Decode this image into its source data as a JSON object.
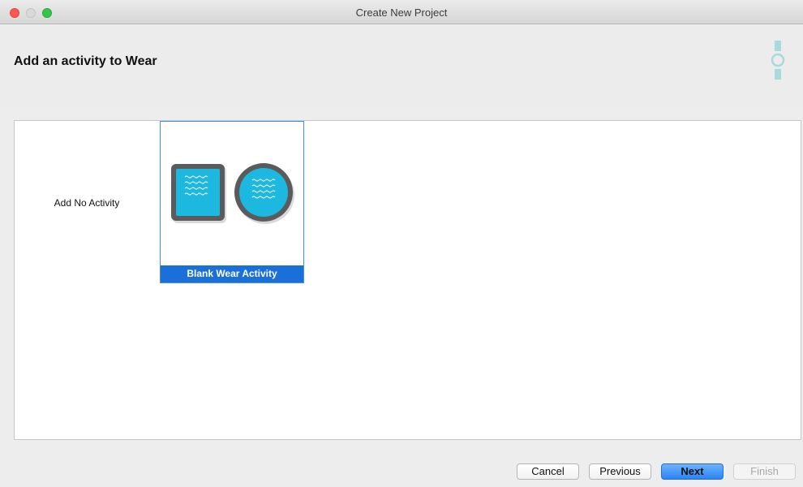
{
  "window": {
    "title": "Create New Project"
  },
  "header": {
    "title": "Add an activity to Wear",
    "icon": "wear-watch-icon",
    "icon_color": "#a8dadc"
  },
  "templates": [
    {
      "label": "Add No Activity",
      "selected": false
    },
    {
      "label": "Blank Wear Activity",
      "selected": true
    }
  ],
  "colors": {
    "selection": "#1a6fd9",
    "wear_screen": "#1cb8e0",
    "wear_bezel": "#5b5b5b"
  },
  "buttons": {
    "cancel": "Cancel",
    "previous": "Previous",
    "next": "Next",
    "finish": "Finish"
  }
}
